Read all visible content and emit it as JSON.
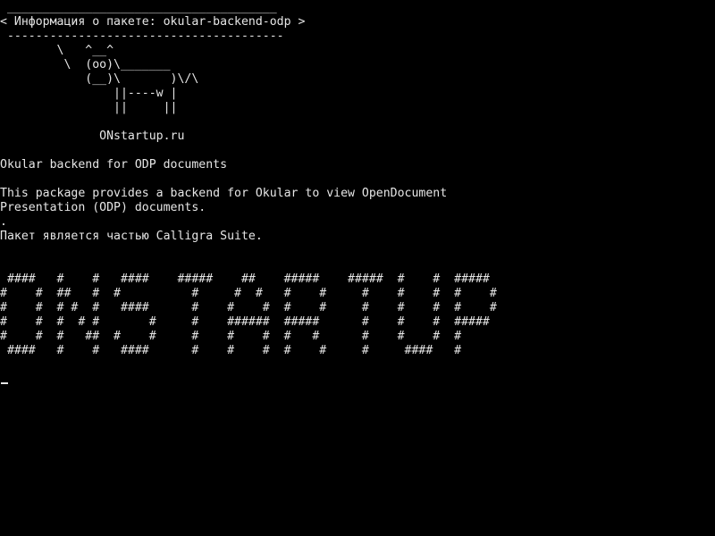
{
  "terminal": {
    "lines": [
      " ______________________________________",
      "< Информация о пакете: okular-backend-odp >",
      " ---------------------------------------",
      "        \\   ^__^",
      "         \\  (oo)\\_______",
      "            (__)\\       )\\/\\",
      "                ||----w |",
      "                ||     ||",
      "",
      "              ONstartup.ru",
      "",
      "Okular backend for ODP documents",
      "",
      "This package provides a backend for Okular to view OpenDocument",
      "Presentation (ODP) documents.",
      ".",
      "Пакет является частью Calligra Suite.",
      "",
      "",
      " ####   #    #   ####    #####    ##    #####    #####  #    #  #####",
      "#    #  ##   #  #          #     #  #   #    #     #    #    #  #    #",
      "#    #  # #  #   ####      #    #    #  #    #     #    #    #  #    #",
      "#    #  #  # #       #     #    ######  #####      #    #    #  #####",
      "#    #  #   ##  #    #     #    #    #  #   #      #    #    #  #",
      " ####   #    #   ####      #    #    #  #    #     #     ####   #",
      ""
    ],
    "colors": {
      "background": "#000000",
      "foreground": "#e6e6e6"
    }
  }
}
